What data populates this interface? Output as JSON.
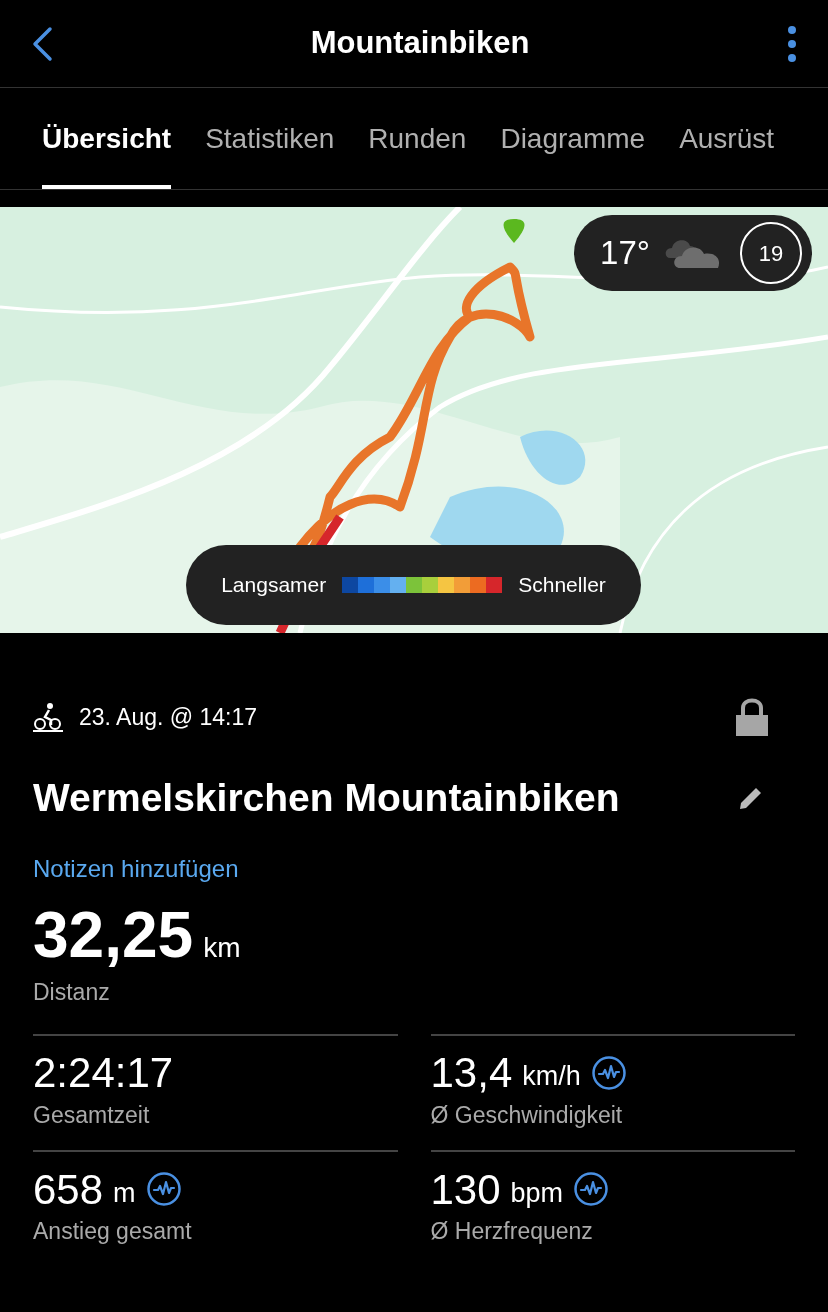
{
  "header": {
    "title": "Mountainbiken"
  },
  "tabs": [
    {
      "label": "Übersicht",
      "selected": true
    },
    {
      "label": "Statistiken",
      "selected": false
    },
    {
      "label": "Runden",
      "selected": false
    },
    {
      "label": "Diagramme",
      "selected": false
    },
    {
      "label": "Ausrüst",
      "selected": false
    }
  ],
  "map": {
    "weather": {
      "temperature": "17°",
      "wind": "19"
    },
    "legend": {
      "slow_label": "Langsamer",
      "fast_label": "Schneller",
      "scale": [
        {
          "color": "#0d47a1"
        },
        {
          "color": "#1e6fd9"
        },
        {
          "color": "#3b8ee8"
        },
        {
          "color": "#64b0f0"
        },
        {
          "color": "#7cc33a"
        },
        {
          "color": "#a8cf3c"
        },
        {
          "color": "#f5c542"
        },
        {
          "color": "#f29d38"
        },
        {
          "color": "#ec6b21"
        },
        {
          "color": "#d6262b"
        }
      ]
    }
  },
  "activity": {
    "date": "23. Aug. @ 14:17",
    "title": "Wermelskirchen Mountainbiken",
    "notes_link": "Notizen hinzufügen",
    "distance": {
      "value": "32,25",
      "unit": "km",
      "label": "Distanz"
    }
  },
  "stats": [
    {
      "value": "2:24:17",
      "label": "Gesamtzeit",
      "has_chart": false
    },
    {
      "value": "13,4",
      "unit": "km/h",
      "label": "Ø Geschwindigkeit",
      "has_chart": true
    },
    {
      "value": "658",
      "unit": "m",
      "label": "Anstieg gesamt",
      "has_chart": true
    },
    {
      "value": "130",
      "unit": "bpm",
      "label": "Ø Herzfrequenz",
      "has_chart": true
    }
  ]
}
